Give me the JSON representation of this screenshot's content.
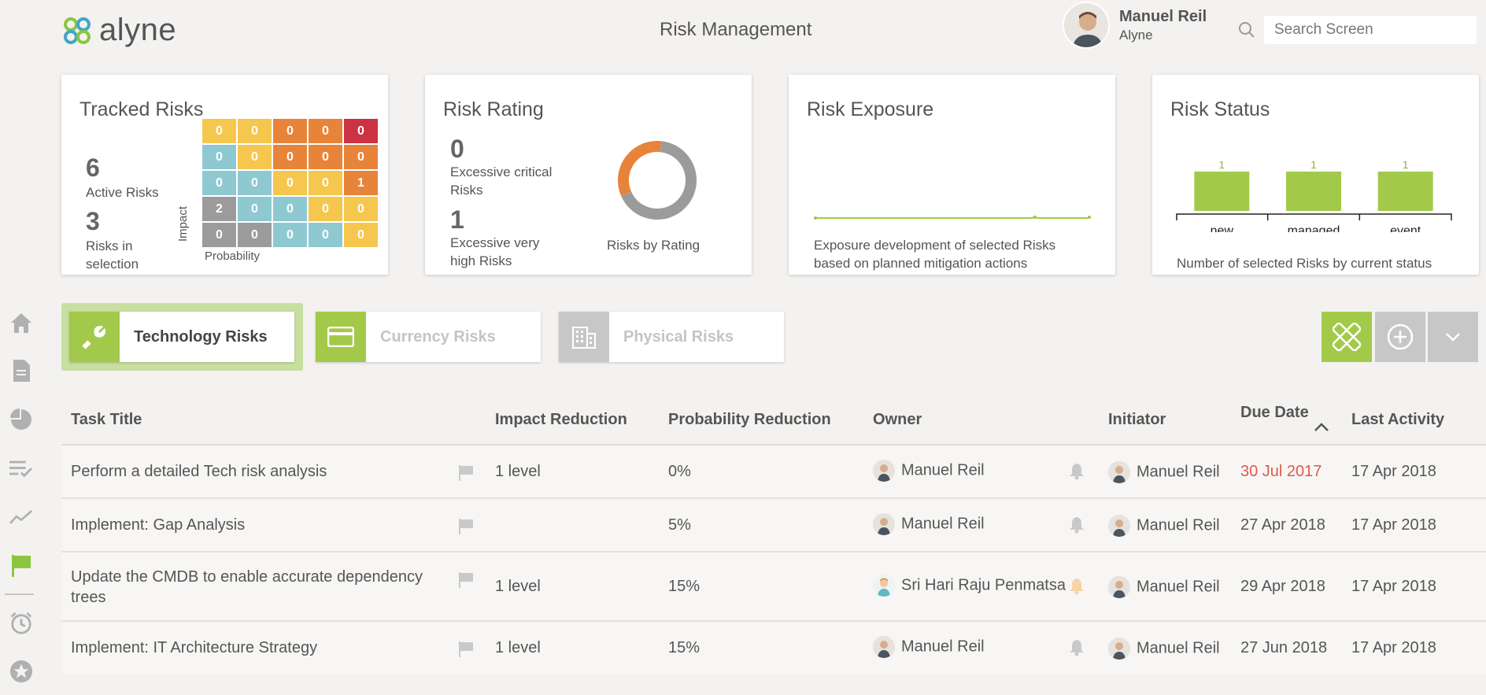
{
  "header": {
    "logo_text": "alyne",
    "page_title": "Risk Management",
    "user_name": "Manuel Reil",
    "user_org": "Alyne",
    "search_placeholder": "Search Screen"
  },
  "cards": {
    "tracked": {
      "title": "Tracked Risks",
      "active_count": "6",
      "active_label": "Active Risks",
      "selection_count": "3",
      "selection_label_1": "Risks in",
      "selection_label_2": "selection",
      "impact_label": "Impact",
      "probability_label": "Probability",
      "matrix": [
        [
          "0",
          "0",
          "0",
          "0",
          "0"
        ],
        [
          "0",
          "0",
          "0",
          "0",
          "0"
        ],
        [
          "0",
          "0",
          "0",
          "0",
          "1"
        ],
        [
          "2",
          "0",
          "0",
          "0",
          "0"
        ],
        [
          "0",
          "0",
          "0",
          "0",
          "0"
        ]
      ],
      "matrix_colors": [
        [
          "#f5c74e",
          "#f5c74e",
          "#e8843a",
          "#e8843a",
          "#cc3342"
        ],
        [
          "#8ec9d2",
          "#f5c74e",
          "#e8843a",
          "#e8843a",
          "#e8843a"
        ],
        [
          "#8ec9d2",
          "#8ec9d2",
          "#f5c74e",
          "#f5c74e",
          "#e8843a"
        ],
        [
          "#9b9b9b",
          "#8ec9d2",
          "#8ec9d2",
          "#f5c74e",
          "#f5c74e"
        ],
        [
          "#9b9b9b",
          "#9b9b9b",
          "#8ec9d2",
          "#8ec9d2",
          "#f5c74e"
        ]
      ]
    },
    "rating": {
      "title": "Risk Rating",
      "critical_count": "0",
      "critical_label_1": "Excessive critical",
      "critical_label_2": "Risks",
      "veryhigh_count": "1",
      "veryhigh_label_1": "Excessive very",
      "veryhigh_label_2": "high Risks",
      "donut_label": "Risks by Rating"
    },
    "exposure": {
      "title": "Risk Exposure",
      "caption_1": "Exposure development of selected Risks",
      "caption_2": "based on planned mitigation actions"
    },
    "status": {
      "title": "Risk Status",
      "caption": "Number of selected Risks by current status"
    }
  },
  "chart_data": [
    {
      "type": "pie",
      "title": "Risks by Rating",
      "categories": [
        "orange",
        "grey"
      ],
      "values": [
        1,
        2
      ]
    },
    {
      "type": "bar",
      "title": "Risk Status",
      "categories": [
        "new",
        "managed",
        "event"
      ],
      "values": [
        1,
        1,
        1
      ]
    }
  ],
  "tabs": [
    {
      "label": "Technology Risks",
      "icon": "wrench-icon",
      "active": true
    },
    {
      "label": "Currency Risks",
      "icon": "credit-card-icon",
      "active": false
    },
    {
      "label": "Physical Risks",
      "icon": "building-icon",
      "active": false
    }
  ],
  "table": {
    "headers": {
      "title": "Task Title",
      "impact": "Impact Reduction",
      "probability": "Probability Reduction",
      "owner": "Owner",
      "initiator": "Initiator",
      "due": "Due Date",
      "activity": "Last Activity"
    },
    "rows": [
      {
        "title": "Perform a detailed Tech risk analysis",
        "impact": "1 level",
        "probability": "0%",
        "owner": "Manuel Reil",
        "initiator": "Manuel Reil",
        "due": "30 Jul 2017",
        "activity": "17 Apr 2018"
      },
      {
        "title": "Implement: Gap Analysis",
        "impact": "",
        "probability": "5%",
        "owner": "Manuel Reil",
        "initiator": "Manuel Reil",
        "due": "27 Apr 2018",
        "activity": "17 Apr 2018"
      },
      {
        "title_1": "Update the CMDB to enable accurate dependency",
        "title_2": "trees",
        "impact": "1 level",
        "probability": "15%",
        "owner": "Sri Hari Raju Penmatsa",
        "initiator": "Manuel Reil",
        "due": "29 Apr 2018",
        "activity": "17 Apr 2018"
      },
      {
        "title": "Implement: IT Architecture Strategy",
        "impact": "1 level",
        "probability": "15%",
        "owner": "Manuel Reil",
        "initiator": "Manuel Reil",
        "due": "27 Jun 2018",
        "activity": "17 Apr 2018"
      }
    ]
  },
  "colors": {
    "green": "#a3c94a",
    "overdue": "#e05a4a"
  }
}
